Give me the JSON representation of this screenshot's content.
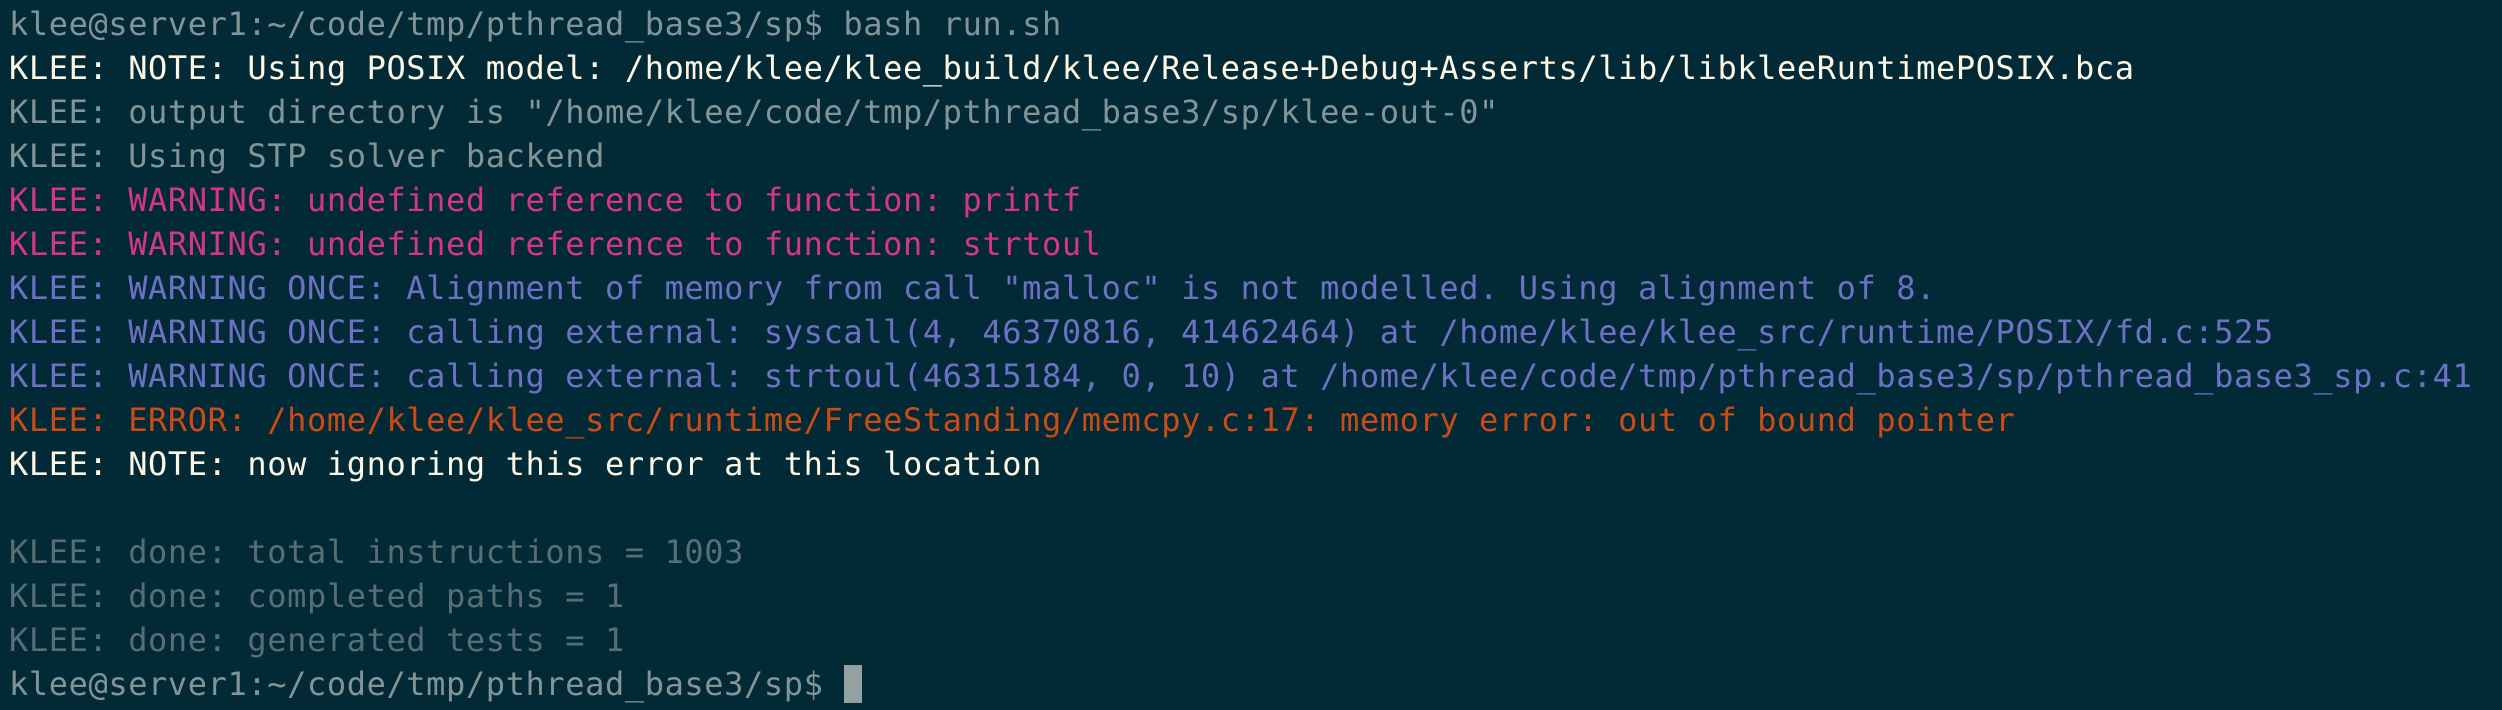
{
  "colors": {
    "background": "#022a36",
    "prompt": "#839496",
    "note": "#fdf6e3",
    "info": "#839496",
    "warning": "#d33682",
    "warning_once": "#6c71c4",
    "error": "#cb4b16",
    "done": "#586e75",
    "cursor": "#93a1a1"
  },
  "terminal": {
    "prompt": "klee@server1:~/code/tmp/pthread_base3/sp$",
    "command": "bash run.sh",
    "lines": [
      "KLEE: NOTE: Using POSIX model: /home/klee/klee_build/klee/Release+Debug+Asserts/lib/libkleeRuntimePOSIX.bca",
      "KLEE: output directory is \"/home/klee/code/tmp/pthread_base3/sp/klee-out-0\"",
      "KLEE: Using STP solver backend",
      "KLEE: WARNING: undefined reference to function: printf",
      "KLEE: WARNING: undefined reference to function: strtoul",
      "KLEE: WARNING ONCE: Alignment of memory from call \"malloc\" is not modelled. Using alignment of 8.",
      "KLEE: WARNING ONCE: calling external: syscall(4, 46370816, 41462464) at /home/klee/klee_src/runtime/POSIX/fd.c:525",
      "KLEE: WARNING ONCE: calling external: strtoul(46315184, 0, 10) at /home/klee/code/tmp/pthread_base3/sp/pthread_base3_sp.c:41",
      "KLEE: ERROR: /home/klee/klee_src/runtime/FreeStanding/memcpy.c:17: memory error: out of bound pointer",
      "KLEE: NOTE: now ignoring this error at this location",
      "",
      "KLEE: done: total instructions = 1003",
      "KLEE: done: completed paths = 1",
      "KLEE: done: generated tests = 1"
    ]
  }
}
